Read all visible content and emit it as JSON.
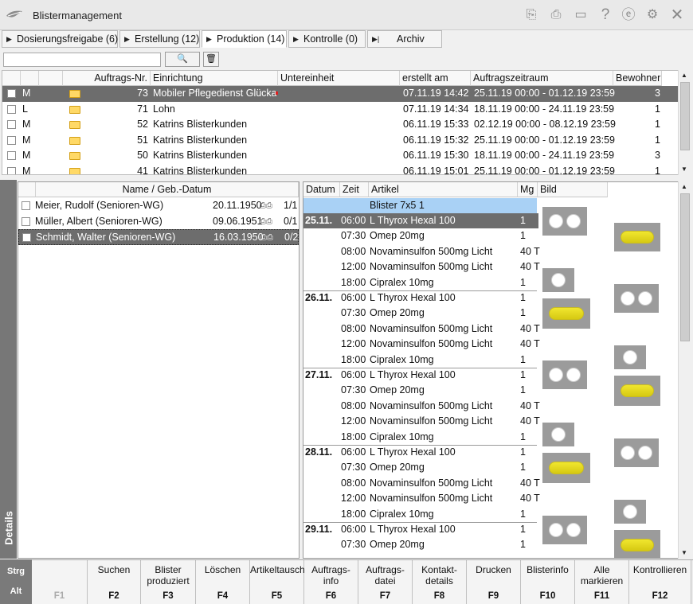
{
  "window": {
    "title": "Blistermanagement"
  },
  "tabs": [
    {
      "label": "Dosierungsfreigabe (6)"
    },
    {
      "label": "Erstellung (12)"
    },
    {
      "label": "Produktion (14)"
    },
    {
      "label": "Kontrolle (0)"
    },
    {
      "label": "Archiv"
    }
  ],
  "orders": {
    "headers": {
      "nr": "Auftrags-Nr.",
      "einrichtung": "Einrichtung",
      "unter": "Untereinheit",
      "erstellt": "erstellt am",
      "zeitraum": "Auftragszeitraum",
      "bewohner": "Bewohner"
    },
    "rows": [
      {
        "type": "M",
        "nr": "73",
        "einrichtung": "Mobiler Pflegedienst Glücka",
        "erstellt": "07.11.19 14:42",
        "zeitraum": "25.11.19 00:00 - 01.12.19 23:59",
        "bewohner": "3"
      },
      {
        "type": "L",
        "nr": "71",
        "einrichtung": "Lohn",
        "erstellt": "07.11.19 14:34",
        "zeitraum": "18.11.19 00:00 - 24.11.19 23:59",
        "bewohner": "1"
      },
      {
        "type": "M",
        "nr": "52",
        "einrichtung": "Katrins Blisterkunden",
        "erstellt": "06.11.19 15:33",
        "zeitraum": "02.12.19 00:00 - 08.12.19 23:59",
        "bewohner": "1"
      },
      {
        "type": "M",
        "nr": "51",
        "einrichtung": "Katrins Blisterkunden",
        "erstellt": "06.11.19 15:32",
        "zeitraum": "25.11.19 00:00 - 01.12.19 23:59",
        "bewohner": "1"
      },
      {
        "type": "M",
        "nr": "50",
        "einrichtung": "Katrins Blisterkunden",
        "erstellt": "06.11.19 15:30",
        "zeitraum": "18.11.19 00:00 - 24.11.19 23:59",
        "bewohner": "3"
      },
      {
        "type": "M",
        "nr": "41",
        "einrichtung": "Katrins Blisterkunden",
        "erstellt": "06.11.19 15:01",
        "zeitraum": "25.11.19 00:00 - 01.12.19 23:59",
        "bewohner": "1"
      }
    ]
  },
  "residents": {
    "header": "Name / Geb.-Datum",
    "rows": [
      {
        "name": "Meier, Rudolf (Senioren-WG)",
        "dob": "20.11.1950",
        "count": "1/1"
      },
      {
        "name": "Müller, Albert (Senioren-WG)",
        "dob": "09.06.1951",
        "count": "0/1"
      },
      {
        "name": "Schmidt, Walter (Senioren-WG)",
        "dob": "16.03.1950",
        "count": "0/2"
      }
    ]
  },
  "meds": {
    "headers": {
      "datum": "Datum",
      "zeit": "Zeit",
      "artikel": "Artikel",
      "mg": "Mg",
      "bild": "Bild"
    },
    "blister": "Blister 7x5 1",
    "rows": [
      {
        "d": "25.11.",
        "t": "06:00",
        "a": "L Thyrox Hexal 100",
        "m": "1"
      },
      {
        "d": "",
        "t": "07:30",
        "a": "Omep 20mg",
        "m": "1"
      },
      {
        "d": "",
        "t": "08:00",
        "a": "Novaminsulfon 500mg Licht",
        "m": "40 T"
      },
      {
        "d": "",
        "t": "12:00",
        "a": "Novaminsulfon 500mg Licht",
        "m": "40 T"
      },
      {
        "d": "",
        "t": "18:00",
        "a": "Cipralex 10mg",
        "m": "1"
      },
      {
        "d": "26.11.",
        "t": "06:00",
        "a": "L Thyrox Hexal 100",
        "m": "1"
      },
      {
        "d": "",
        "t": "07:30",
        "a": "Omep 20mg",
        "m": "1"
      },
      {
        "d": "",
        "t": "08:00",
        "a": "Novaminsulfon 500mg Licht",
        "m": "40 T"
      },
      {
        "d": "",
        "t": "12:00",
        "a": "Novaminsulfon 500mg Licht",
        "m": "40 T"
      },
      {
        "d": "",
        "t": "18:00",
        "a": "Cipralex 10mg",
        "m": "1"
      },
      {
        "d": "27.11.",
        "t": "06:00",
        "a": "L Thyrox Hexal 100",
        "m": "1"
      },
      {
        "d": "",
        "t": "07:30",
        "a": "Omep 20mg",
        "m": "1"
      },
      {
        "d": "",
        "t": "08:00",
        "a": "Novaminsulfon 500mg Licht",
        "m": "40 T"
      },
      {
        "d": "",
        "t": "12:00",
        "a": "Novaminsulfon 500mg Licht",
        "m": "40 T"
      },
      {
        "d": "",
        "t": "18:00",
        "a": "Cipralex 10mg",
        "m": "1"
      },
      {
        "d": "28.11.",
        "t": "06:00",
        "a": "L Thyrox Hexal 100",
        "m": "1"
      },
      {
        "d": "",
        "t": "07:30",
        "a": "Omep 20mg",
        "m": "1"
      },
      {
        "d": "",
        "t": "08:00",
        "a": "Novaminsulfon 500mg Licht",
        "m": "40 T"
      },
      {
        "d": "",
        "t": "12:00",
        "a": "Novaminsulfon 500mg Licht",
        "m": "40 T"
      },
      {
        "d": "",
        "t": "18:00",
        "a": "Cipralex 10mg",
        "m": "1"
      },
      {
        "d": "29.11.",
        "t": "06:00",
        "a": "L Thyrox Hexal 100",
        "m": "1"
      },
      {
        "d": "",
        "t": "07:30",
        "a": "Omep 20mg",
        "m": "1"
      }
    ]
  },
  "details_label": "Details",
  "modifiers": {
    "strg": "Strg",
    "alt": "Alt"
  },
  "fkeys": [
    {
      "label": "",
      "key": "F1"
    },
    {
      "label": "Suchen",
      "key": "F2"
    },
    {
      "label": "Blister produziert",
      "key": "F3"
    },
    {
      "label": "Löschen",
      "key": "F4"
    },
    {
      "label": "Artikeltausch",
      "key": "F5"
    },
    {
      "label": "Auftrags-info",
      "key": "F6"
    },
    {
      "label": "Auftrags-datei",
      "key": "F7"
    },
    {
      "label": "Kontakt-details",
      "key": "F8"
    },
    {
      "label": "Drucken",
      "key": "F9"
    },
    {
      "label": "Blisterinfo",
      "key": "F10"
    },
    {
      "label": "Alle markieren",
      "key": "F11"
    },
    {
      "label": "Kontrollieren",
      "key": "F12"
    }
  ],
  "icons": [
    "app-logo-icon",
    "copy-icon",
    "print-icon",
    "monitor-icon",
    "help-icon",
    "e-icon",
    "settings-icon",
    "close-icon",
    "search-icon",
    "trash-icon",
    "folder-icon",
    "tablet-icon",
    "capsule-icon"
  ],
  "colors": {
    "selection": "#6d6d6d",
    "blister_header": "#a9d1f5",
    "capsule": "#e8dc22"
  }
}
